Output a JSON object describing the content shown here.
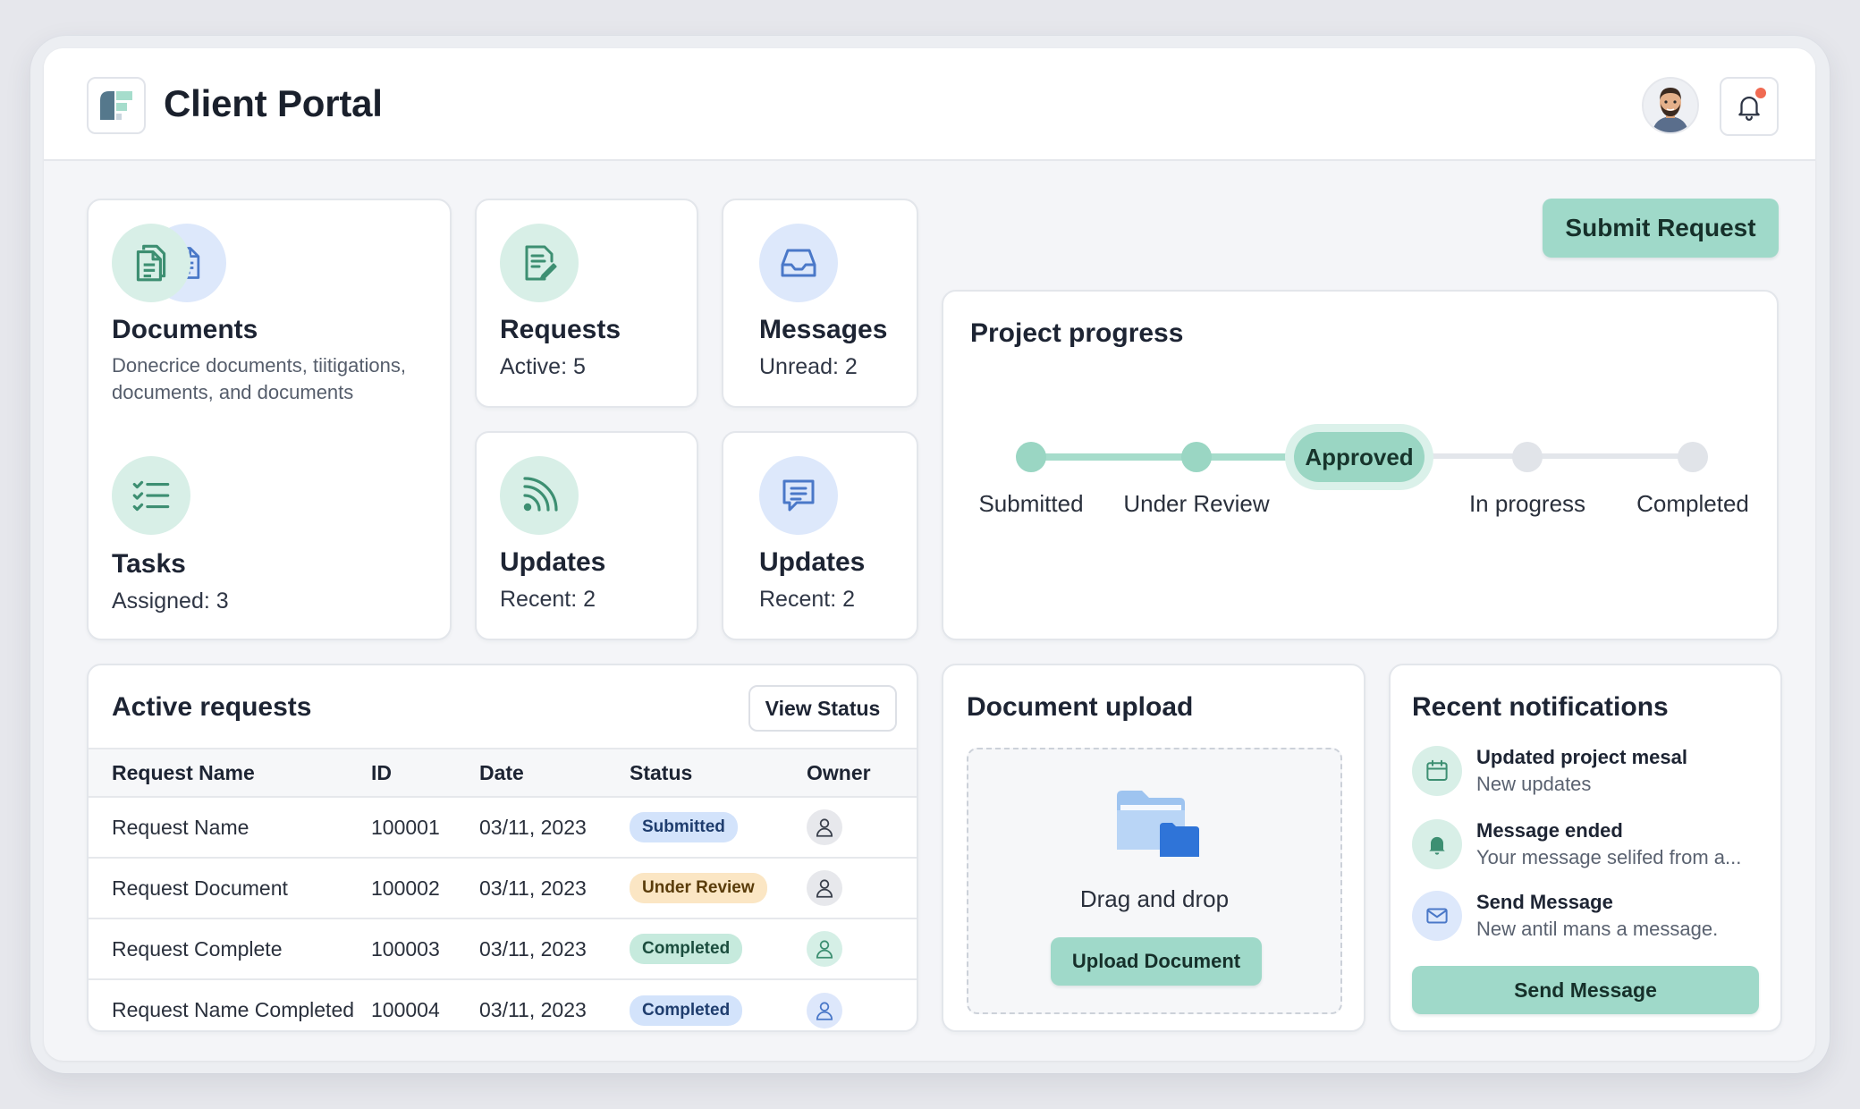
{
  "app": {
    "title": "Client Portal"
  },
  "header": {
    "avatar": "user-avatar",
    "notifications_icon": "bell-icon",
    "has_unread": true
  },
  "colors": {
    "accent": "#9fd9c9",
    "accent_dark": "#7cc9b2",
    "icon_green_bg": "#d8efe7",
    "icon_blue_bg": "#dde8fb",
    "alert": "#f06a52"
  },
  "cards": {
    "documents": {
      "title": "Documents",
      "description": "Donecrice documents, tiitigations, documents, and documents",
      "icons": [
        "documents-icon",
        "file-icon"
      ]
    },
    "tasks": {
      "title": "Tasks",
      "subtitle": "Assigned: 3",
      "icon": "checklist-icon"
    },
    "requests": {
      "title": "Requests",
      "subtitle": "Active: 5",
      "icon": "edit-document-icon"
    },
    "messages": {
      "title": "Messages",
      "subtitle": "Unread: 2",
      "icon": "inbox-icon"
    },
    "updates_feed": {
      "title": "Updates",
      "subtitle": "Recent: 2",
      "icon": "rss-icon"
    },
    "updates_chat": {
      "title": "Updates",
      "subtitle": "Recent: 2",
      "icon": "chat-icon"
    }
  },
  "submit_request": {
    "label": "Submit Request"
  },
  "project_progress": {
    "title": "Project progress",
    "steps": [
      "Submitted",
      "Under Review",
      "Approved",
      "In progress",
      "Completed"
    ],
    "current_step": "Approved",
    "completed_steps": 2
  },
  "active_requests": {
    "title": "Active requests",
    "view_status_label": "View Status",
    "columns": [
      "Request Name",
      "ID",
      "Date",
      "Status",
      "Owner"
    ],
    "rows": [
      {
        "name": "Request Name",
        "id": "100001",
        "date": "03/11, 2023",
        "status": "Submitted",
        "owner": "user-icon"
      },
      {
        "name": "Request Document",
        "id": "100002",
        "date": "03/11, 2023",
        "status": "Under Review",
        "owner": "user-icon"
      },
      {
        "name": "Request Complete",
        "id": "100003",
        "date": "03/11, 2023",
        "status": "Completed",
        "owner": "user-icon"
      },
      {
        "name": "Request Name Completed",
        "id": "100004",
        "date": "03/11, 2023",
        "status": "Completed",
        "owner": "user-icon"
      }
    ]
  },
  "document_upload": {
    "title": "Document upload",
    "dropzone_text": "Drag and drop",
    "upload_label": "Upload Document",
    "icon": "folder-icon"
  },
  "recent_notifications": {
    "title": "Recent notifications",
    "items": [
      {
        "title": "Updated project mesal",
        "subtitle": "New updates",
        "icon": "calendar-icon"
      },
      {
        "title": "Message ended",
        "subtitle": "Your message selifed from a...",
        "icon": "bell-icon"
      },
      {
        "title": "Send Message",
        "subtitle": "New antil mans a message.",
        "icon": "mail-icon"
      }
    ],
    "send_label": "Send Message"
  }
}
